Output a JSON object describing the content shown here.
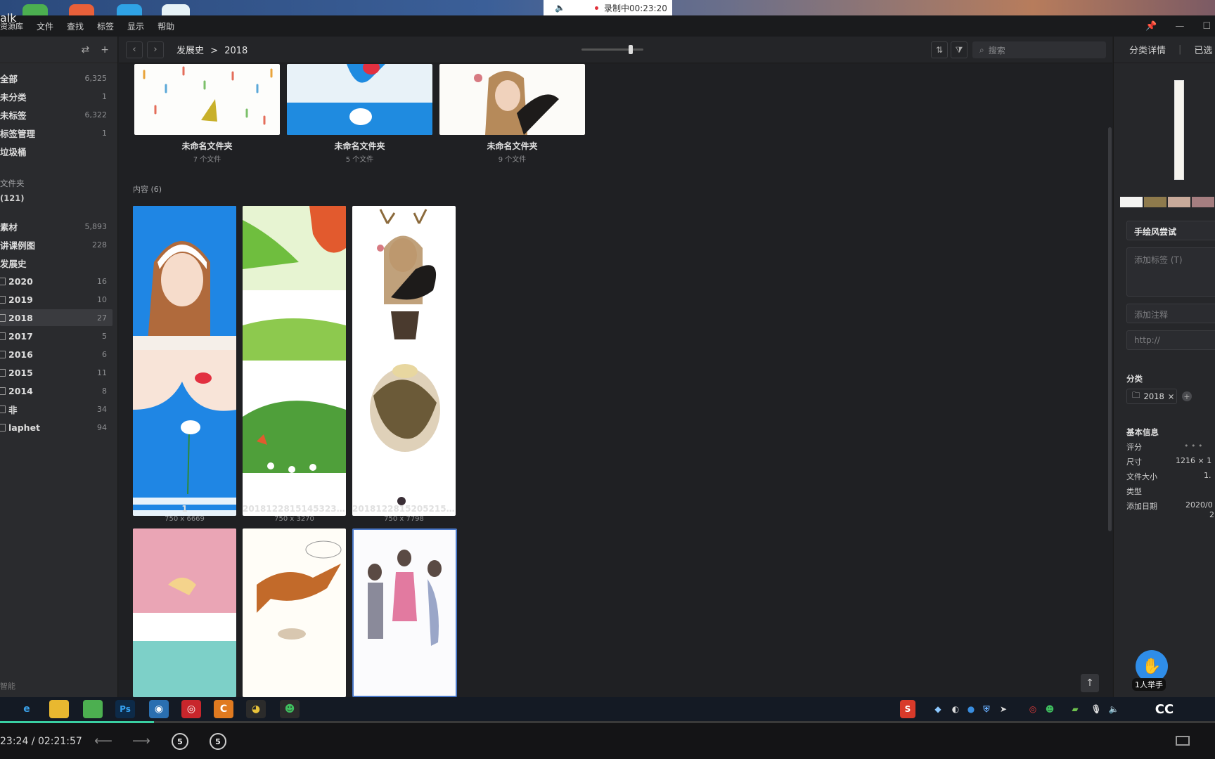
{
  "recording": {
    "label": "录制中00:23:20"
  },
  "app": {
    "title_fragment": "alk",
    "menu": [
      "文件",
      "查找",
      "标签",
      "显示",
      "帮助"
    ],
    "menu_prefix": "资源库"
  },
  "sidebar": {
    "items": [
      {
        "label": "全部",
        "count": "6,325"
      },
      {
        "label": "未分类",
        "count": "1"
      },
      {
        "label": "未标签",
        "count": "6,322"
      },
      {
        "label": "标签管理",
        "count": "1"
      },
      {
        "label": "垃圾桶",
        "count": ""
      }
    ],
    "folders_header": "文件夹",
    "folders_count": "(121)",
    "folders": [
      {
        "label": "素材",
        "count": "5,893"
      },
      {
        "label": "讲课例图",
        "count": "228"
      },
      {
        "label": "发展史",
        "count": ""
      }
    ],
    "years": [
      {
        "label": "2020",
        "count": "16"
      },
      {
        "label": "2019",
        "count": "10"
      },
      {
        "label": "2018",
        "count": "27",
        "selected": true
      },
      {
        "label": "2017",
        "count": "5"
      },
      {
        "label": "2016",
        "count": "6"
      },
      {
        "label": "2015",
        "count": "11"
      },
      {
        "label": "2014",
        "count": "8"
      },
      {
        "label": "非",
        "count": "34"
      },
      {
        "label": "laphet",
        "count": "94"
      }
    ],
    "footer": "智能"
  },
  "toolbar": {
    "crumb_parent": "发展史",
    "crumb_sep": ">",
    "crumb_current": "2018",
    "search_placeholder": "搜索",
    "zoom_level": 0.8
  },
  "folders_row": [
    {
      "name": "未命名文件夹",
      "count": "7 个文件"
    },
    {
      "name": "未命名文件夹",
      "count": "5 个文件"
    },
    {
      "name": "未命名文件夹",
      "count": "9 个文件"
    }
  ],
  "content_section": "内容 (6)",
  "items": [
    {
      "name": "1",
      "size": "750 x 6669"
    },
    {
      "name": "2018122815145323937 3...",
      "size": "750 x 3270"
    },
    {
      "name": "2018122815205215928 0...",
      "size": "750 x 7798"
    }
  ],
  "right_panel": {
    "tab1": "分类详情",
    "tab2": "已选",
    "colors": [
      "#f4f4f2",
      "#8e7a4c",
      "#c8aa9a",
      "#a57e80"
    ],
    "title_value": "手绘风尝试",
    "tag_placeholder": "添加标签 (T)",
    "note_placeholder": "添加注释",
    "url_placeholder": "http://",
    "category_label": "分类",
    "category_chip": "2018",
    "basic_info_label": "基本信息",
    "info": [
      {
        "k": "评分",
        "v": "• • •"
      },
      {
        "k": "尺寸",
        "v": "1216 × 1"
      },
      {
        "k": "文件大小",
        "v": "1."
      },
      {
        "k": "类型",
        "v": ""
      },
      {
        "k": "添加日期",
        "v": "2020/0"
      }
    ],
    "date_extra": "2"
  },
  "raise_hand": "1人举手",
  "video": {
    "time": "23:24 / 02:21:57",
    "back_label": "5",
    "fwd_label": "5",
    "progress": 0.127
  }
}
